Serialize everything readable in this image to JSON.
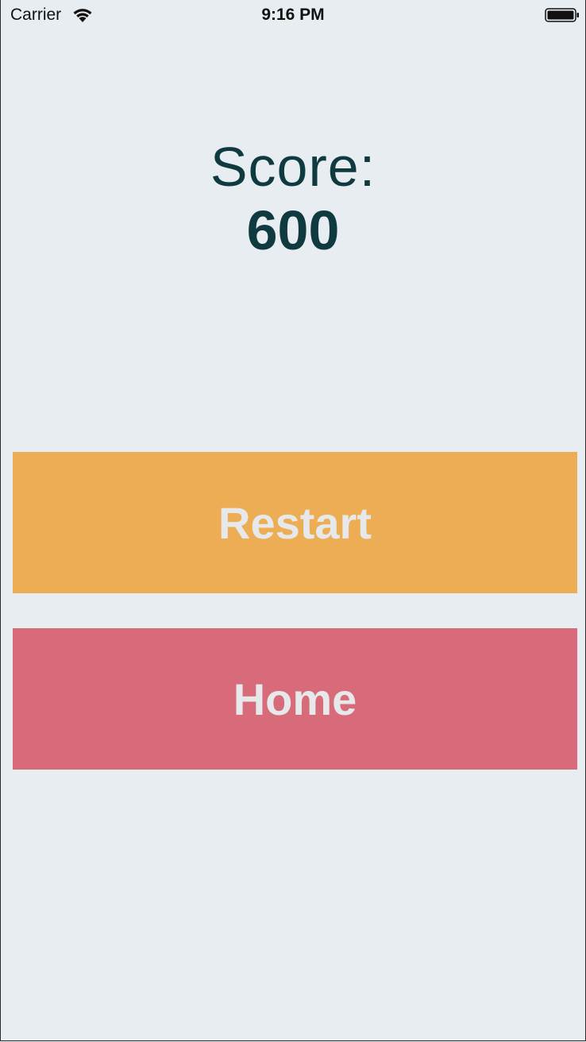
{
  "status_bar": {
    "carrier": "Carrier",
    "time": "9:16 PM",
    "wifi_icon": "wifi-icon",
    "battery_icon": "battery-icon"
  },
  "score": {
    "label": "Score:",
    "value": "600"
  },
  "buttons": {
    "restart": {
      "label": "Restart",
      "color": "#ecad54"
    },
    "home": {
      "label": "Home",
      "color": "#d86b7a"
    }
  },
  "colors": {
    "background": "#e8edf1",
    "score_text": "#0f3a40",
    "button_text": "#e6e8ea"
  }
}
